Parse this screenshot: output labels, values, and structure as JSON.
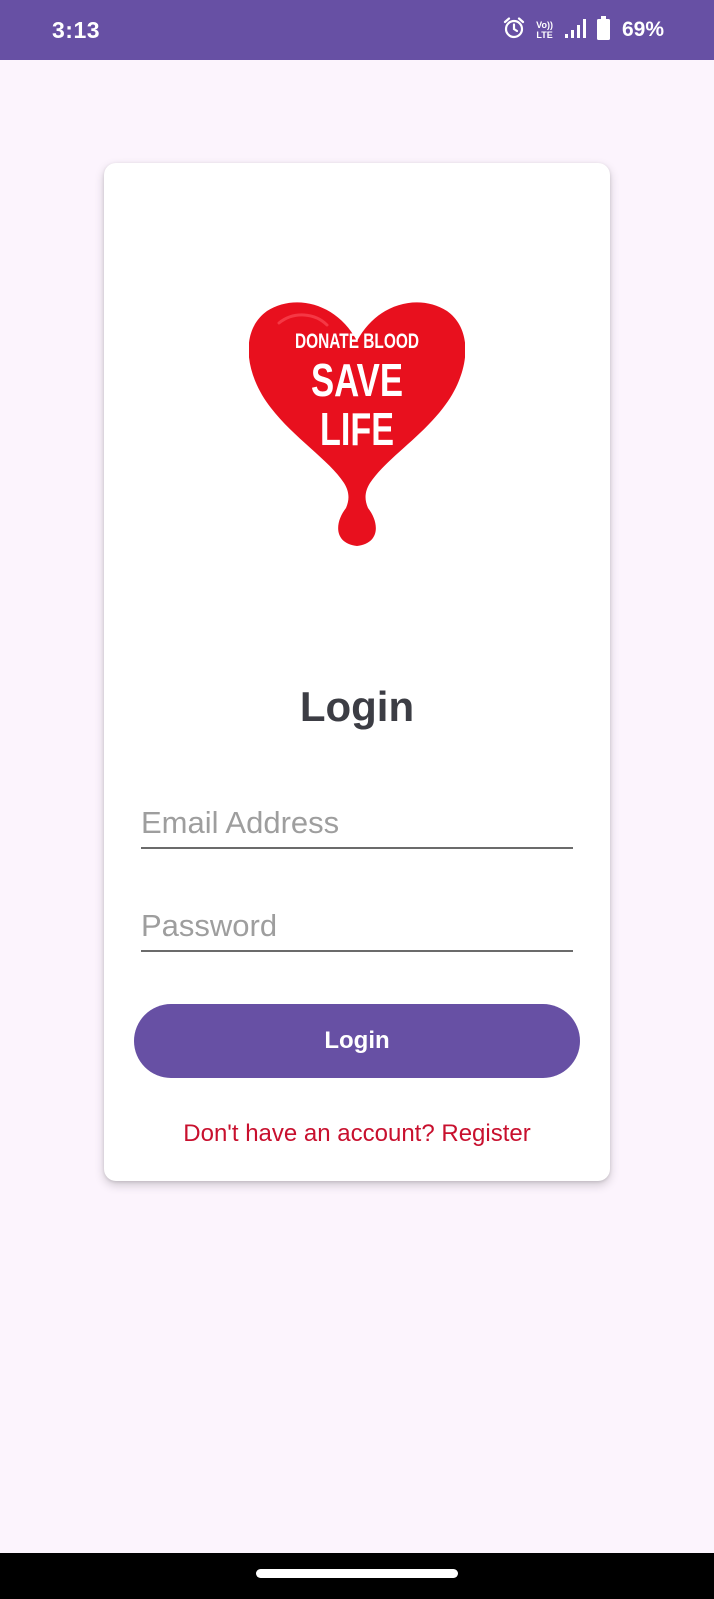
{
  "status_bar": {
    "time": "3:13",
    "volte_top": "Vo))",
    "volte_bottom": "LTE",
    "battery_percent": "69%",
    "background_color": "#6750A4",
    "icons": [
      "alarm-icon",
      "volte-lte-icon",
      "signal-icon",
      "battery-icon"
    ]
  },
  "logo": {
    "line1": "DONATE BLOOD",
    "line2": "SAVE",
    "line3": "LIFE",
    "color": "#E8101E"
  },
  "login": {
    "title": "Login",
    "email_placeholder": "Email Address",
    "email_value": "",
    "password_placeholder": "Password",
    "password_value": "",
    "button_label": "Login",
    "register_text": "Don't have an account? Register"
  },
  "colors": {
    "accent": "#6750A4",
    "page_background": "#FCF4FD",
    "link": "#C8102E",
    "title_text": "#3C3D44"
  }
}
